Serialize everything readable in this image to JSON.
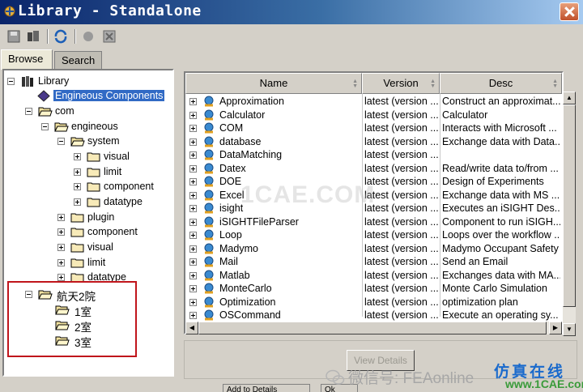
{
  "window": {
    "title": "Library - Standalone"
  },
  "toolbar": {
    "buttons": [
      "save-icon",
      "library-icon",
      "refresh-icon",
      "component-icon",
      "close-doc-icon"
    ]
  },
  "tabs": [
    {
      "label": "Browse",
      "active": true
    },
    {
      "label": "Search",
      "active": false
    }
  ],
  "tree": {
    "root": "Library",
    "engineous_components": "Engineous Components",
    "com": "com",
    "engineous": "engineous",
    "system": "system",
    "system_children": [
      "visual",
      "limit",
      "component",
      "datatype"
    ],
    "engineous_children": [
      "plugin",
      "component",
      "visual",
      "limit",
      "datatype"
    ],
    "custom_root": "航天2院",
    "custom_children": [
      "1室",
      "2室",
      "3室"
    ]
  },
  "table": {
    "columns": [
      "Name",
      "Version",
      "Desc"
    ],
    "rows": [
      {
        "name": "Approximation",
        "version": "latest (version ...",
        "desc": "Construct an approximat..."
      },
      {
        "name": "Calculator",
        "version": "latest (version ...",
        "desc": "Calculator"
      },
      {
        "name": "COM",
        "version": "latest (version ...",
        "desc": "Interacts with Microsoft ..."
      },
      {
        "name": "database",
        "version": "latest (version ...",
        "desc": "Exchange data with Data..."
      },
      {
        "name": "DataMatching",
        "version": "latest (version ...",
        "desc": ""
      },
      {
        "name": "Datex",
        "version": "latest (version ...",
        "desc": "Read/write data to/from ..."
      },
      {
        "name": "DOE",
        "version": "latest (version ...",
        "desc": "Design of Experiments"
      },
      {
        "name": "Excel",
        "version": "latest (version ...",
        "desc": "Exchange data with MS ..."
      },
      {
        "name": "isight",
        "version": "latest (version ...",
        "desc": "Executes an iSIGHT Des..."
      },
      {
        "name": "iSIGHTFileParser",
        "version": "latest (version ...",
        "desc": "Component to run iSIGH..."
      },
      {
        "name": "Loop",
        "version": "latest (version ...",
        "desc": "Loops over the workflow ..."
      },
      {
        "name": "Madymo",
        "version": "latest (version ...",
        "desc": "Madymo Occupant Safety"
      },
      {
        "name": "Mail",
        "version": "latest (version ...",
        "desc": "Send an Email"
      },
      {
        "name": "Matlab",
        "version": "latest (version ...",
        "desc": "Exchanges data with MA..."
      },
      {
        "name": "MonteCarlo",
        "version": "latest (version ...",
        "desc": "Monte Carlo Simulation"
      },
      {
        "name": "Optimization",
        "version": "latest (version ...",
        "desc": "optimization plan"
      },
      {
        "name": "OSCommand",
        "version": "latest (version ...",
        "desc": "Execute an operating sy..."
      }
    ]
  },
  "buttons": {
    "view_details": "View Details",
    "add_to_details": "Add to Details",
    "ok": "Ok"
  },
  "watermarks": {
    "center": "1CAE.COM",
    "wechat": "微信号: FEAonline",
    "site_cn": "仿真在线",
    "site_url": "www.1CAE.com"
  },
  "colors": {
    "title_bar": "#0a246a",
    "selection": "#316ac5",
    "highlight_box": "#c0151b"
  }
}
